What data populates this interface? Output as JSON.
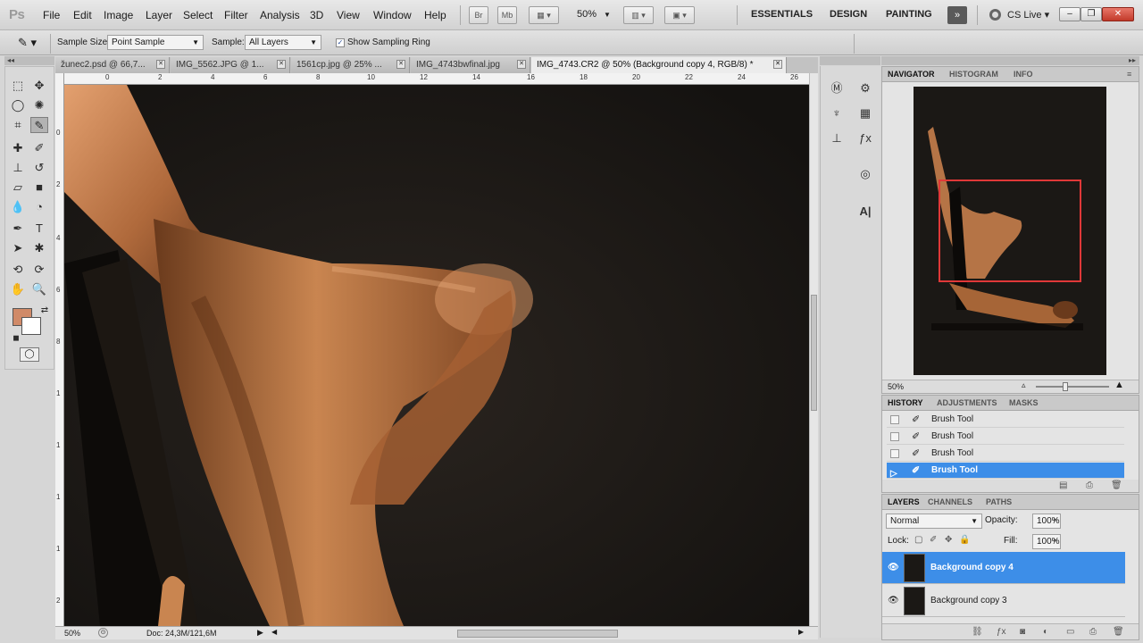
{
  "app": {
    "logo": "Ps"
  },
  "menubar": {
    "items": [
      "File",
      "Edit",
      "Image",
      "Layer",
      "Select",
      "Filter",
      "Analysis",
      "3D",
      "View",
      "Window",
      "Help"
    ],
    "bridge_label": "Br",
    "minibridge_label": "Mb",
    "zoom_value": "50%",
    "workspaces": [
      "ESSENTIALS",
      "DESIGN",
      "PAINTING"
    ],
    "more_arrow": "»",
    "cs_live": "CS Live",
    "window_buttons": [
      "–",
      "❐",
      "✕"
    ]
  },
  "options": {
    "sample_size_label": "Sample Size:",
    "sample_size_value": "Point Sample",
    "sample_label": "Sample:",
    "sample_value": "All Layers",
    "show_ring_label": "Show Sampling Ring",
    "show_ring_checked": "✓"
  },
  "tabs": [
    {
      "label": "žunec2.psd @ 66,7...",
      "close": "✕"
    },
    {
      "label": "IMG_5562.JPG @ 1...",
      "close": "✕"
    },
    {
      "label": "1561cp.jpg @ 25% ...",
      "close": "✕"
    },
    {
      "label": "IMG_4743bwfinal.jpg",
      "close": "✕"
    },
    {
      "label": "IMG_4743.CR2 @ 50% (Background copy 4, RGB/8) *",
      "close": "✕"
    }
  ],
  "ruler": {
    "h_labels": [
      "0",
      "2",
      "4",
      "6",
      "8",
      "10",
      "12",
      "14",
      "16",
      "18",
      "20",
      "22",
      "24",
      "26"
    ],
    "v_labels": [
      "0",
      "2",
      "4",
      "6",
      "8",
      "1",
      "1",
      "1",
      "1",
      "2",
      "2"
    ]
  },
  "colors": {
    "foreground": "#d08a68",
    "background": "#ffffff",
    "selection": "#3d8ee8"
  },
  "status": {
    "zoom": "50%",
    "doc": "Doc: 24,3M/121,6M"
  },
  "navigator": {
    "tabs": [
      "NAVIGATOR",
      "HISTOGRAM",
      "INFO"
    ],
    "zoom": "50%"
  },
  "history": {
    "tabs": [
      "HISTORY",
      "ADJUSTMENTS",
      "MASKS"
    ],
    "items": [
      "Brush Tool",
      "Brush Tool",
      "Brush Tool",
      "Brush Tool"
    ]
  },
  "layers": {
    "tabs": [
      "LAYERS",
      "CHANNELS",
      "PATHS"
    ],
    "blend_mode": "Normal",
    "opacity_label": "Opacity:",
    "opacity_value": "100%",
    "lock_label": "Lock:",
    "fill_label": "Fill:",
    "fill_value": "100%",
    "rows": [
      "Background copy 4",
      "Background copy 3"
    ]
  }
}
